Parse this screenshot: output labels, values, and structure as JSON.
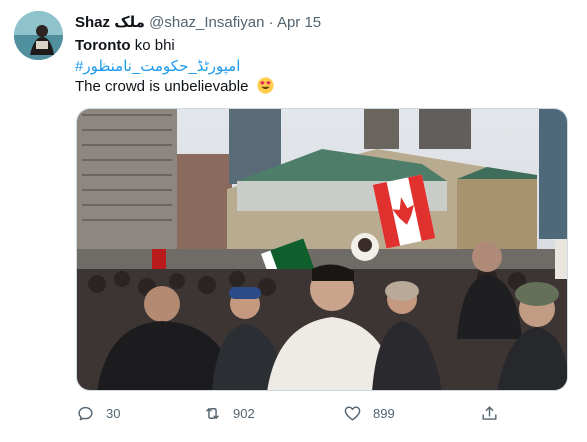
{
  "tweet": {
    "display_name": "Shaz ملک",
    "handle": "@shaz_Insafiyan",
    "separator": "·",
    "date": "Apr 15",
    "text_line1_bold": "Toronto",
    "text_line1_rest": " ko bhi",
    "hashtag": "#امپورٹڈ_حکومت_نامنظور",
    "text_line3": "The crowd is unbelievable",
    "emoji": "heart-eyes-emoji"
  },
  "actions": {
    "reply_count": "30",
    "retweet_count": "902",
    "like_count": "899",
    "share_icon": "share-icon"
  },
  "colors": {
    "link": "#1d9bf0",
    "secondary_text": "#536471",
    "border": "#cfd9de"
  }
}
